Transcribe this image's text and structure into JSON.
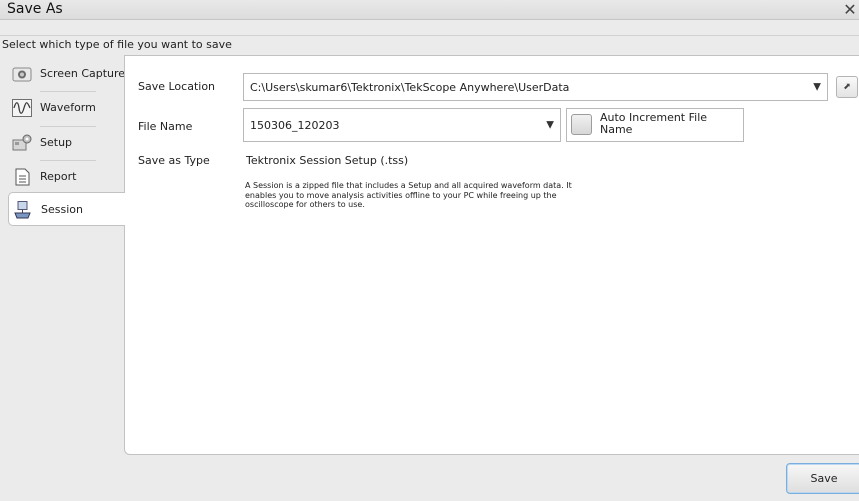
{
  "window": {
    "title": "Save As",
    "close_symbol": "✕"
  },
  "instruction": "Select which type of file you want to save",
  "nav": {
    "items": [
      {
        "label": "Screen Capture",
        "icon": "camera-icon",
        "active": false
      },
      {
        "label": "Waveform",
        "icon": "waveform-icon",
        "active": false
      },
      {
        "label": "Setup",
        "icon": "setup-icon",
        "active": false
      },
      {
        "label": "Report",
        "icon": "report-icon",
        "active": false
      },
      {
        "label": "Session",
        "icon": "session-icon",
        "active": true
      }
    ]
  },
  "form": {
    "save_location_label": "Save Location",
    "save_location_value": "C:\\Users\\skumar6\\Tektronix\\TekScope Anywhere\\UserData",
    "file_name_label": "File Name",
    "file_name_value": "150306_120203",
    "auto_increment_label": "Auto Increment File Name",
    "auto_increment_checked": false,
    "save_as_type_label": "Save as Type",
    "save_as_type_value": "Tektronix Session Setup (.tss)",
    "description": "A Session is a zipped file that includes a Setup and all acquired waveform data. It enables you to move analysis activities offline to your PC while freeing up the oscilloscope for others to use."
  },
  "actions": {
    "save_label": "Save"
  },
  "colors": {
    "accent_border": "#79aede",
    "panel_background": "#ffffff",
    "window_background": "#ebebeb"
  }
}
